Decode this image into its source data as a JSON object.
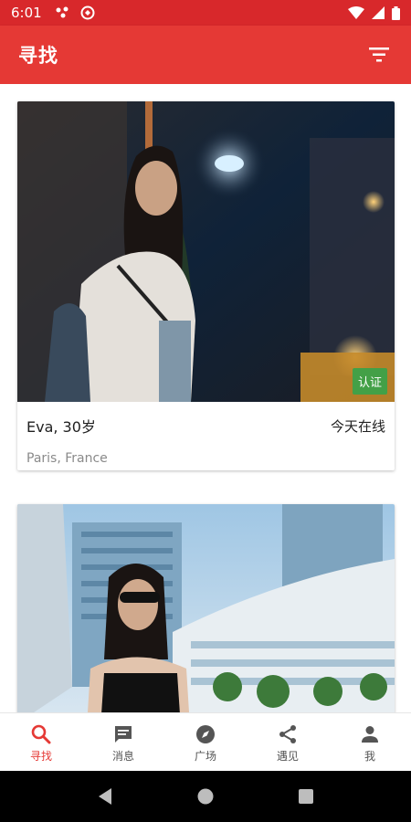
{
  "status_bar": {
    "time": "6:01"
  },
  "app_bar": {
    "title": "寻找"
  },
  "profiles": [
    {
      "name_age": "Eva, 30岁",
      "online": "今天在线",
      "location": "Paris, France",
      "badge": "认证"
    },
    {
      "name_age": "",
      "online": "",
      "location": "",
      "badge": ""
    }
  ],
  "bottom_nav": [
    {
      "label": "寻找",
      "icon": "search-icon",
      "active": true
    },
    {
      "label": "消息",
      "icon": "message-icon",
      "active": false
    },
    {
      "label": "广场",
      "icon": "compass-icon",
      "active": false
    },
    {
      "label": "遇见",
      "icon": "share-icon",
      "active": false
    },
    {
      "label": "我",
      "icon": "person-icon",
      "active": false
    }
  ],
  "colors": {
    "primary": "#e53935",
    "status_bar": "#d8282b",
    "verified": "#43a047"
  }
}
